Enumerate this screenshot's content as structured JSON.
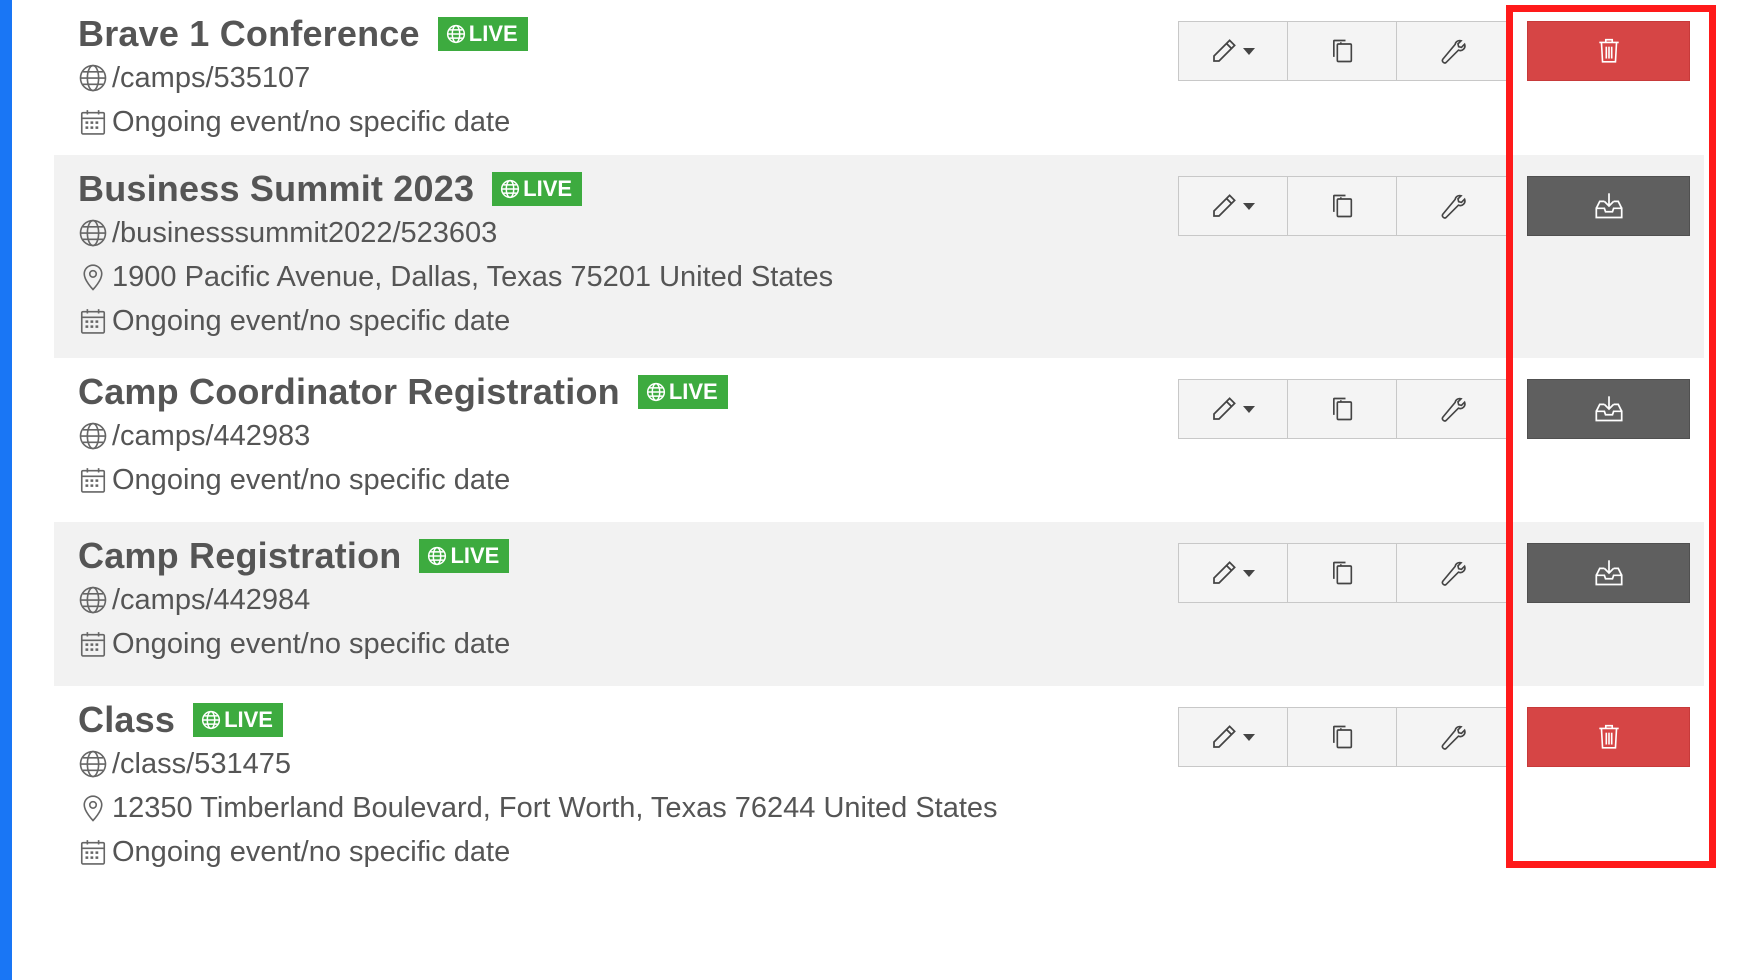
{
  "badge_label": "LIVE",
  "colors": {
    "live_badge": "#3dab3f",
    "delete_button": "#d64545",
    "download_button": "#5f5f5f",
    "highlight_border": "#ff1a1a",
    "row_shade": "#f2f2f2",
    "left_accent": "#1976f5"
  },
  "events": [
    {
      "title": "Brave 1 Conference",
      "path": "/camps/535107",
      "address": "",
      "date": "Ongoing event/no specific date",
      "action": "delete"
    },
    {
      "title": "Business Summit 2023",
      "path": "/businesssummit2022/523603",
      "address": "1900 Pacific Avenue, Dallas, Texas 75201 United States",
      "date": "Ongoing event/no specific date",
      "action": "download"
    },
    {
      "title": "Camp Coordinator Registration",
      "path": "/camps/442983",
      "address": "",
      "date": "Ongoing event/no specific date",
      "action": "download"
    },
    {
      "title": "Camp Registration",
      "path": "/camps/442984",
      "address": "",
      "date": "Ongoing event/no specific date",
      "action": "download"
    },
    {
      "title": "Class",
      "path": "/class/531475",
      "address": "12350 Timberland Boulevard, Fort Worth, Texas 76244 United States",
      "date": "Ongoing event/no specific date",
      "action": "delete"
    }
  ],
  "icons": {
    "globe": "globe-icon",
    "map_pin": "map-pin-icon",
    "calendar": "calendar-icon",
    "edit": "pencil-icon",
    "dropdown": "caret-down-icon",
    "copy": "copy-icon",
    "settings": "wrench-icon",
    "delete": "trash-icon",
    "download": "download-icon"
  }
}
